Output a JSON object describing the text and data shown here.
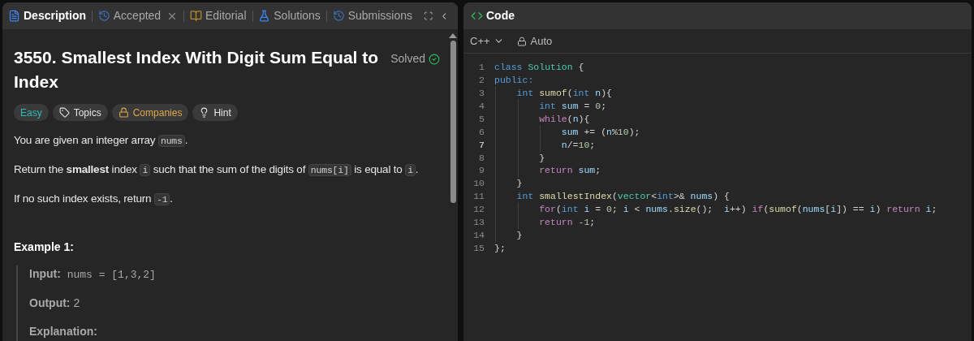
{
  "left_panel": {
    "tabs": [
      {
        "label": "Description",
        "selected": true
      },
      {
        "label": "Accepted",
        "selected": false,
        "closable": true
      },
      {
        "label": "Editorial",
        "selected": false
      },
      {
        "label": "Solutions",
        "selected": false
      },
      {
        "label": "Submissions",
        "selected": false
      }
    ],
    "problem": {
      "title": "3550. Smallest Index With Digit Sum Equal to Index",
      "status": "Solved",
      "tags": [
        {
          "label": "Easy",
          "color": "#2cbbb5"
        },
        {
          "label": "Topics",
          "color": "#e6e6e6"
        },
        {
          "label": "Companies",
          "color": "#e0a64a"
        },
        {
          "label": "Hint",
          "color": "#e6e6e6"
        }
      ],
      "paragraphs": [
        [
          {
            "kind": "text",
            "text": "You are given an integer array "
          },
          {
            "kind": "code",
            "text": "nums"
          },
          {
            "kind": "text",
            "text": "."
          }
        ],
        [
          {
            "kind": "text",
            "text": "Return the **smallest** index "
          },
          {
            "kind": "code",
            "text": "i"
          },
          {
            "kind": "text",
            "text": " such that the sum of the digits of "
          },
          {
            "kind": "code",
            "text": "nums[i]"
          },
          {
            "kind": "text",
            "text": " is equal to "
          },
          {
            "kind": "code",
            "text": "i"
          },
          {
            "kind": "text",
            "text": "."
          }
        ],
        [
          {
            "kind": "text",
            "text": "If no such index exists, return "
          },
          {
            "kind": "code",
            "text": "-1"
          },
          {
            "kind": "text",
            "text": "."
          }
        ]
      ],
      "example": {
        "heading": "Example 1:",
        "lines": [
          {
            "label": "Input:",
            "value": "nums = [1,3,2]",
            "kind": "code"
          },
          {
            "label": "Output:",
            "value": "2",
            "kind": "text"
          },
          {
            "label": "Explanation:",
            "kind": "label"
          }
        ]
      }
    }
  },
  "code_panel": {
    "title": "Code",
    "language": "C++",
    "mode": "Auto",
    "lines": [
      {
        "number": "1",
        "current": false,
        "tokens": [
          {
            "kind": "kw",
            "text": "class "
          },
          {
            "kind": "type",
            "text": "Solution"
          },
          {
            "kind": "p",
            "text": " {"
          }
        ]
      },
      {
        "number": "2",
        "current": false,
        "tokens": [
          {
            "kind": "kw",
            "text": "public:"
          }
        ]
      },
      {
        "number": "3",
        "current": false,
        "tokens": [
          {
            "kind": "kw",
            "text": "    int "
          },
          {
            "kind": "fn",
            "text": "sumof"
          },
          {
            "kind": "p",
            "text": "("
          },
          {
            "kind": "kw",
            "text": "int "
          },
          {
            "kind": "var",
            "text": "n"
          },
          {
            "kind": "p",
            "text": "){"
          }
        ]
      },
      {
        "number": "4",
        "current": false,
        "tokens": [
          {
            "kind": "kw",
            "text": "        int "
          },
          {
            "kind": "var",
            "text": "sum"
          },
          {
            "kind": "p",
            "text": " = "
          },
          {
            "kind": "num",
            "text": "0"
          },
          {
            "kind": "p",
            "text": ";"
          }
        ]
      },
      {
        "number": "5",
        "current": false,
        "tokens": [
          {
            "kind": "ctrl",
            "text": "        while"
          },
          {
            "kind": "p",
            "text": "("
          },
          {
            "kind": "var",
            "text": "n"
          },
          {
            "kind": "p",
            "text": "){"
          }
        ]
      },
      {
        "number": "6",
        "current": false,
        "tokens": [
          {
            "kind": "var",
            "text": "            sum"
          },
          {
            "kind": "p",
            "text": " += ("
          },
          {
            "kind": "var",
            "text": "n"
          },
          {
            "kind": "p",
            "text": "%"
          },
          {
            "kind": "num",
            "text": "10"
          },
          {
            "kind": "p",
            "text": ");"
          }
        ]
      },
      {
        "number": "7",
        "current": true,
        "tokens": [
          {
            "kind": "var",
            "text": "            n"
          },
          {
            "kind": "p",
            "text": "/="
          },
          {
            "kind": "num",
            "text": "10"
          },
          {
            "kind": "p",
            "text": ";"
          }
        ]
      },
      {
        "number": "8",
        "current": false,
        "tokens": [
          {
            "kind": "p",
            "text": "        }"
          }
        ]
      },
      {
        "number": "9",
        "current": false,
        "tokens": [
          {
            "kind": "ctrl",
            "text": "        return "
          },
          {
            "kind": "var",
            "text": "sum"
          },
          {
            "kind": "p",
            "text": ";"
          }
        ]
      },
      {
        "number": "10",
        "current": false,
        "tokens": [
          {
            "kind": "p",
            "text": "    }"
          }
        ]
      },
      {
        "number": "11",
        "current": false,
        "tokens": [
          {
            "kind": "kw",
            "text": "    int "
          },
          {
            "kind": "fn",
            "text": "smallestIndex"
          },
          {
            "kind": "p",
            "text": "("
          },
          {
            "kind": "type",
            "text": "vector"
          },
          {
            "kind": "p",
            "text": "<"
          },
          {
            "kind": "kw",
            "text": "int"
          },
          {
            "kind": "p",
            "text": ">& "
          },
          {
            "kind": "var",
            "text": "nums"
          },
          {
            "kind": "p",
            "text": ") {"
          }
        ]
      },
      {
        "number": "12",
        "current": false,
        "tokens": [
          {
            "kind": "ctrl",
            "text": "        for"
          },
          {
            "kind": "p",
            "text": "("
          },
          {
            "kind": "kw",
            "text": "int "
          },
          {
            "kind": "var",
            "text": "i"
          },
          {
            "kind": "p",
            "text": " = "
          },
          {
            "kind": "num",
            "text": "0"
          },
          {
            "kind": "p",
            "text": "; "
          },
          {
            "kind": "var",
            "text": "i"
          },
          {
            "kind": "p",
            "text": " < "
          },
          {
            "kind": "var",
            "text": "nums"
          },
          {
            "kind": "p",
            "text": "."
          },
          {
            "kind": "fn",
            "text": "size"
          },
          {
            "kind": "p",
            "text": "();  "
          },
          {
            "kind": "var",
            "text": "i"
          },
          {
            "kind": "p",
            "text": "++) "
          },
          {
            "kind": "ctrl",
            "text": "if"
          },
          {
            "kind": "p",
            "text": "("
          },
          {
            "kind": "fn",
            "text": "sumof"
          },
          {
            "kind": "p",
            "text": "("
          },
          {
            "kind": "var",
            "text": "nums"
          },
          {
            "kind": "p",
            "text": "["
          },
          {
            "kind": "var",
            "text": "i"
          },
          {
            "kind": "p",
            "text": "]) == "
          },
          {
            "kind": "var",
            "text": "i"
          },
          {
            "kind": "p",
            "text": ") "
          },
          {
            "kind": "ctrl",
            "text": "return "
          },
          {
            "kind": "var",
            "text": "i"
          },
          {
            "kind": "p",
            "text": ";"
          }
        ]
      },
      {
        "number": "13",
        "current": false,
        "tokens": [
          {
            "kind": "ctrl",
            "text": "        return "
          },
          {
            "kind": "num",
            "text": "-1"
          },
          {
            "kind": "p",
            "text": ";"
          }
        ]
      },
      {
        "number": "14",
        "current": false,
        "tokens": [
          {
            "kind": "p",
            "text": "    }"
          }
        ]
      },
      {
        "number": "15",
        "current": false,
        "tokens": [
          {
            "kind": "p",
            "text": "};"
          }
        ]
      }
    ]
  }
}
